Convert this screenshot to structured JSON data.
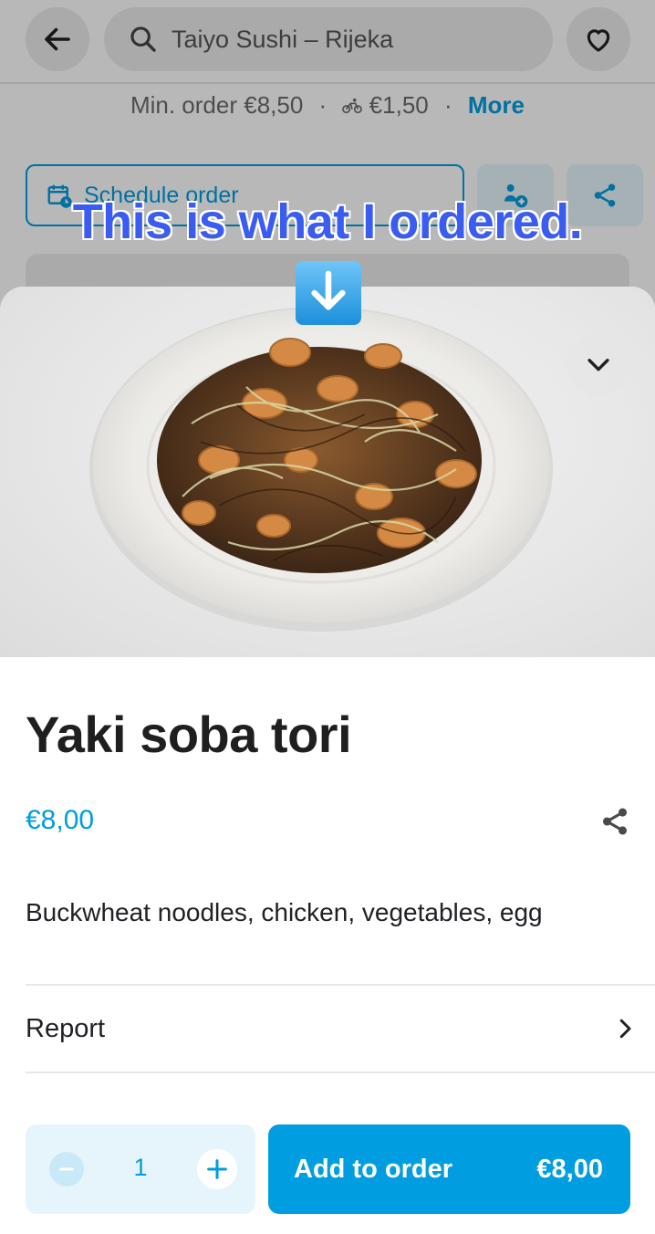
{
  "header": {
    "search_text": "Taiyo Sushi – Rijeka"
  },
  "venue_info": {
    "min_order": "Min. order €8,50",
    "delivery_fee": "€1,50",
    "more_label": "More"
  },
  "actions": {
    "schedule_label": "Schedule order"
  },
  "overlay": {
    "caption": "This is what I ordered."
  },
  "item": {
    "name": "Yaki soba tori",
    "price": "€8,00",
    "description": "Buckwheat noodles, chicken, vegetables, egg",
    "report_label": "Report"
  },
  "order": {
    "quantity": "1",
    "add_label": "Add to order",
    "total": "€8,00"
  },
  "colors": {
    "accent": "#009de0",
    "caption": "#3a5cf0"
  }
}
